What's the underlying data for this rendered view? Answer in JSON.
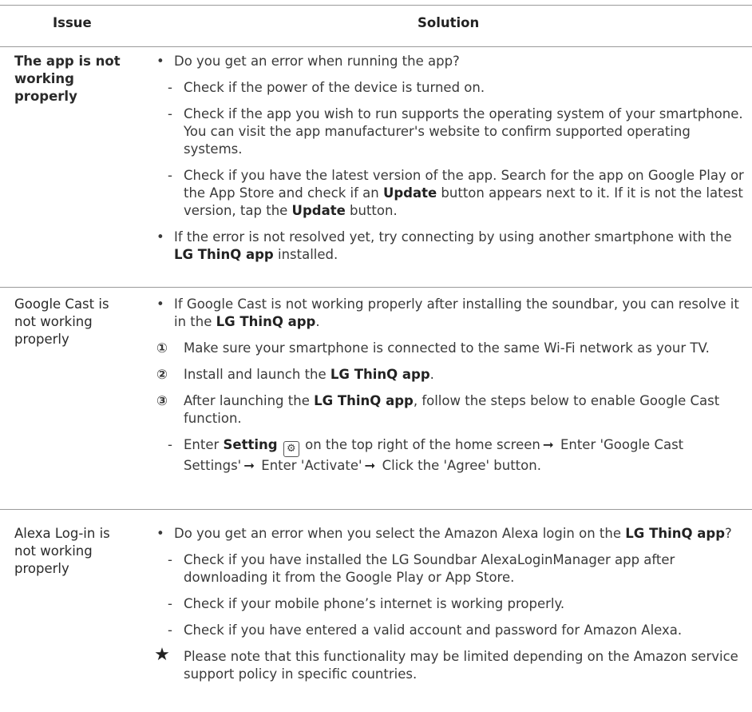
{
  "header": {
    "issue": "Issue",
    "solution": "Solution"
  },
  "rows": [
    {
      "issue": "The app is not working properly",
      "q1": "Do you get an error when running the app?",
      "d1": "Check if the power of the device is turned on.",
      "d2": "Check if the app you wish to run supports the operating system of your smartphone. You can visit the app manufacturer's website to confirm supported operating systems.",
      "d3a": "Check if you have the latest version of the app. Search for the app on Google Play or the App Store and check if an ",
      "d3b": "Update",
      "d3c": " button appears next to it. If it is not the latest version, tap the ",
      "d3d": "Update",
      "d3e": " button.",
      "q2a": "If the error is not resolved yet, try connecting by using another smartphone with the ",
      "q2b": "LG ThinQ app",
      "q2c": " installed."
    },
    {
      "issue": "Google Cast is not working properly",
      "q1a": "If Google Cast is not working properly after installing the soundbar, you can resolve it in the ",
      "q1b": "LG ThinQ app",
      "q1c": ".",
      "n1_mark": "①",
      "n1": "Make sure your smartphone is connected to the same Wi-Fi network as your TV.",
      "n2_mark": "②",
      "n2a": "Install and launch the ",
      "n2b": "LG ThinQ app",
      "n2c": ".",
      "n3_mark": "③",
      "n3a": "After launching the ",
      "n3b": "LG ThinQ app",
      "n3c": ", follow the steps below to enable Google Cast function.",
      "d1a": "Enter ",
      "d1b": "Setting",
      "d1c": " on the top right of the home screen",
      "d1d": " Enter 'Google Cast Settings'",
      "d1e": " Enter 'Activate'",
      "d1f": " Click the 'Agree' button.",
      "arrow": "➞",
      "gear": "⚙"
    },
    {
      "issue": "Alexa Log-in is not working properly",
      "q1a": "Do you get an error when you select the Amazon Alexa login on the ",
      "q1b": "LG ThinQ app",
      "q1c": "?",
      "d1": "Check if you have installed the LG Soundbar AlexaLoginManager app after downloading it from the Google Play or App Store.",
      "d2": "Check if your mobile phone’s internet is working properly.",
      "d3": "Check if you have entered a valid account and password for Amazon Alexa.",
      "star_mark": "★",
      "note": "Please note that this functionality may be limited depending on the Amazon service support policy in specific countries."
    }
  ],
  "marks": {
    "bullet": "•",
    "dash": "-"
  }
}
